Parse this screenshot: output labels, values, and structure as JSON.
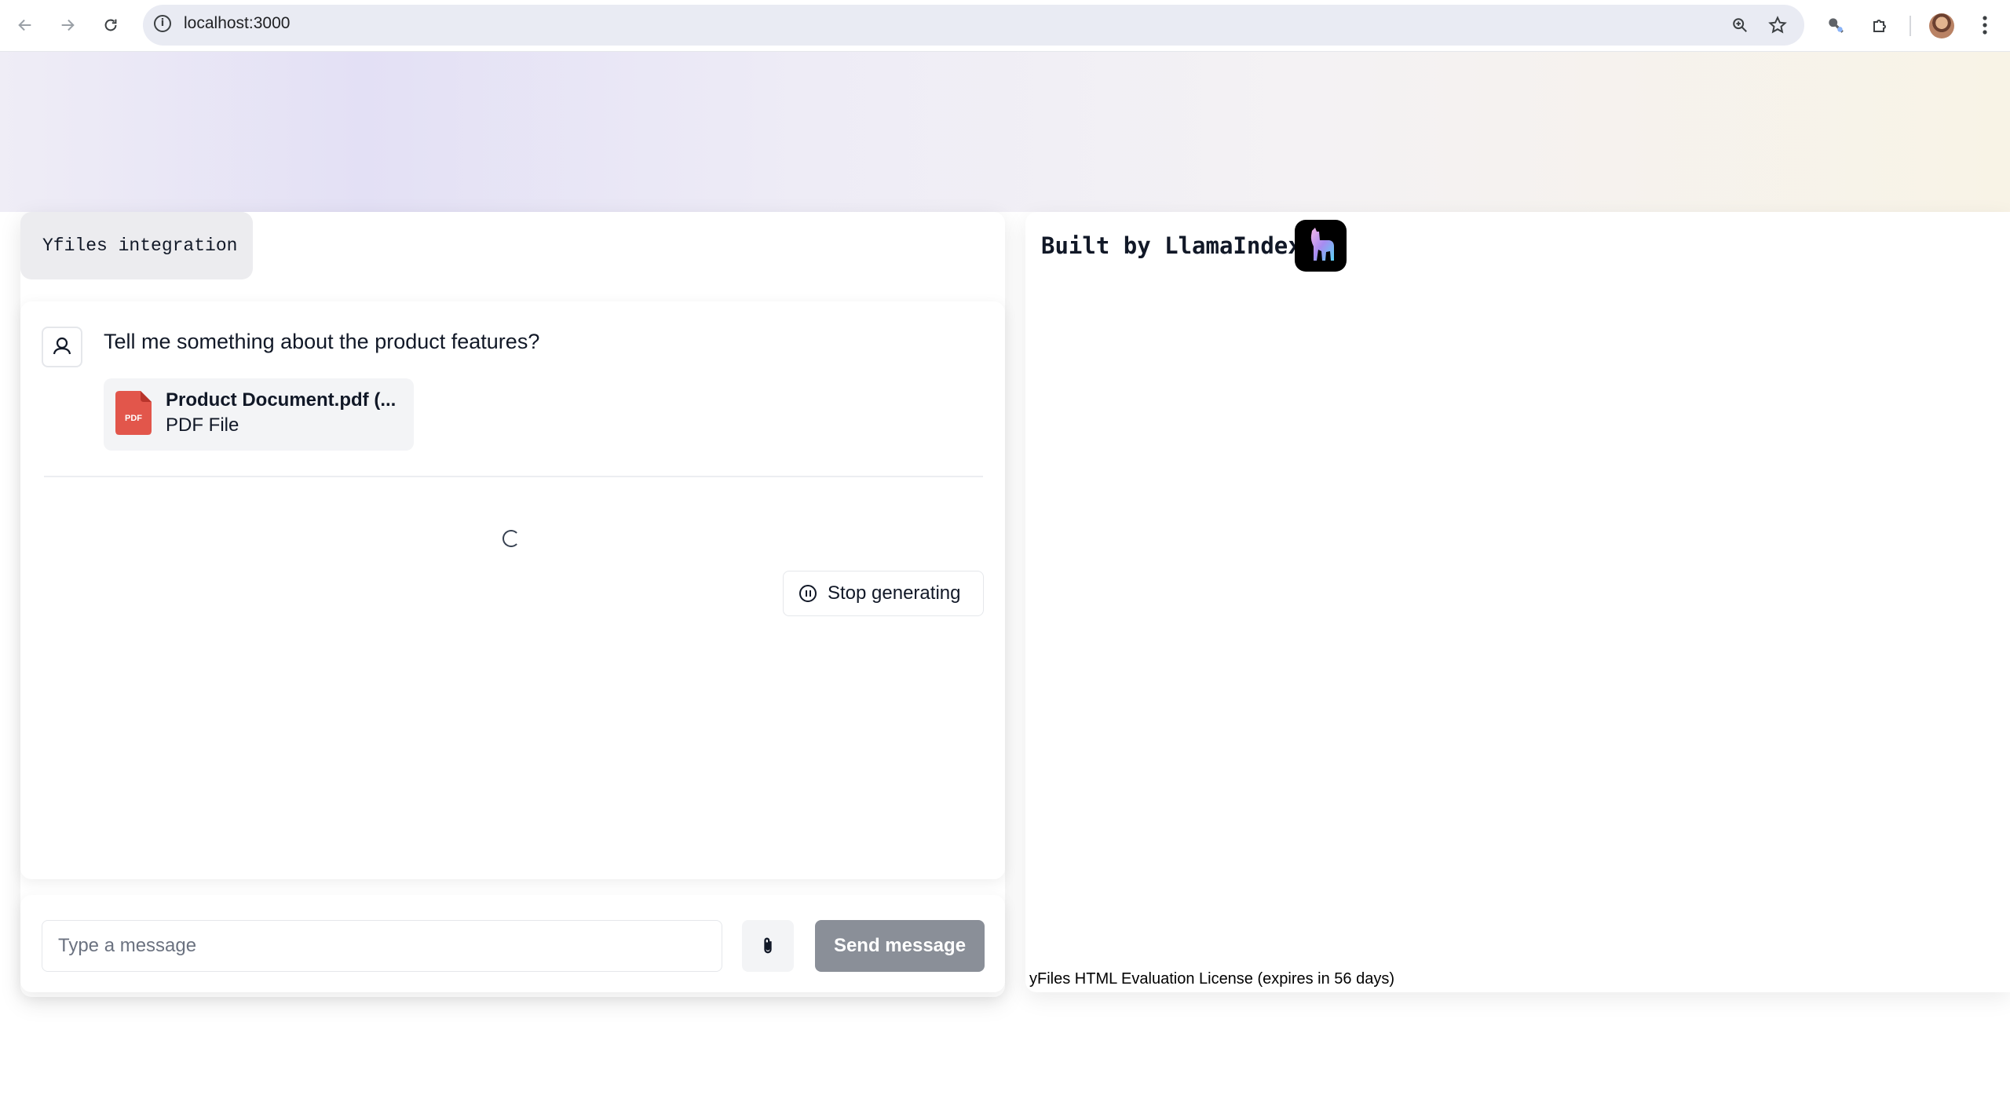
{
  "browser": {
    "url": "localhost:3000",
    "back_icon": "arrow-left-icon",
    "forward_icon": "arrow-right-icon",
    "reload_icon": "reload-icon",
    "site_info_icon": "info-icon",
    "zoom_icon": "zoom-icon",
    "bookmark_icon": "star-icon",
    "extensions_icon": "puzzle-icon",
    "menu_icon": "kebab-menu-icon"
  },
  "header": {
    "tab_label": "Yfiles integration",
    "built_by": "Built by LlamaIndex"
  },
  "chat": {
    "user_message": "Tell me something about the product features?",
    "attachment": {
      "badge": "PDF",
      "name": "Product Document.pdf (...",
      "type": "PDF File"
    },
    "stop_label": "Stop generating"
  },
  "composer": {
    "placeholder": "Type a message",
    "send_label": "Send message"
  },
  "graph_panel": {
    "license_text": "yFiles HTML Evaluation License (expires in 56 days)"
  },
  "colors": {
    "file_icon": "#e2564b",
    "send_button": "#8a8f98",
    "logo_bg": "#000000"
  }
}
